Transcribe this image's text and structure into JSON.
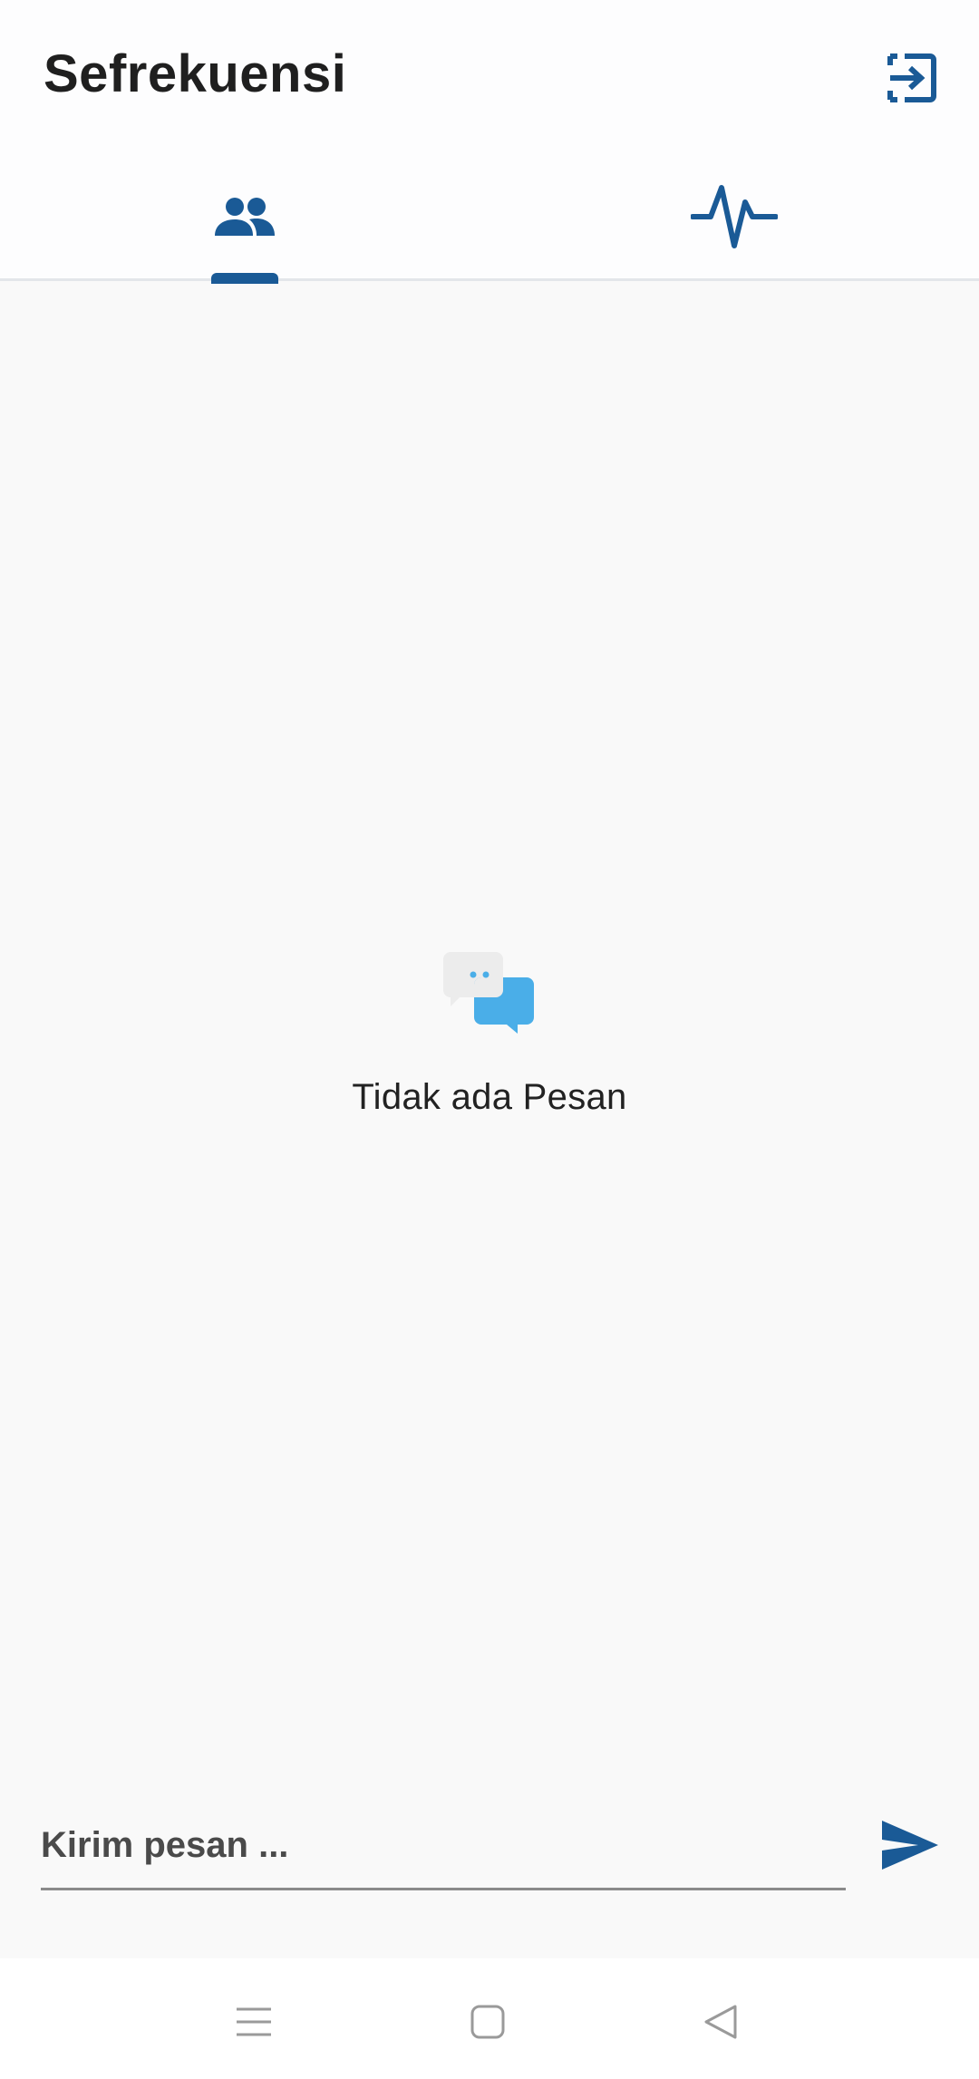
{
  "app": {
    "title": "Sefrekuensi"
  },
  "header": {
    "logout_icon": "logout-icon"
  },
  "tabs": [
    {
      "icon": "people-icon",
      "selected": true
    },
    {
      "icon": "activity-pulse-icon",
      "selected": false
    }
  ],
  "empty_state": {
    "icon": "chat-bubbles-icon",
    "message": "Tidak ada Pesan"
  },
  "composer": {
    "placeholder": "Kirim pesan ...",
    "value": "",
    "send_icon": "send-icon"
  },
  "system_nav": {
    "menu_icon": "menu-icon",
    "home_icon": "home-icon",
    "back_icon": "back-icon"
  },
  "colors": {
    "primary": "#1a5a96",
    "chat_bubble_blue": "#4aaee8",
    "chat_bubble_grey": "#ececec",
    "background": "#f9f9f9"
  }
}
